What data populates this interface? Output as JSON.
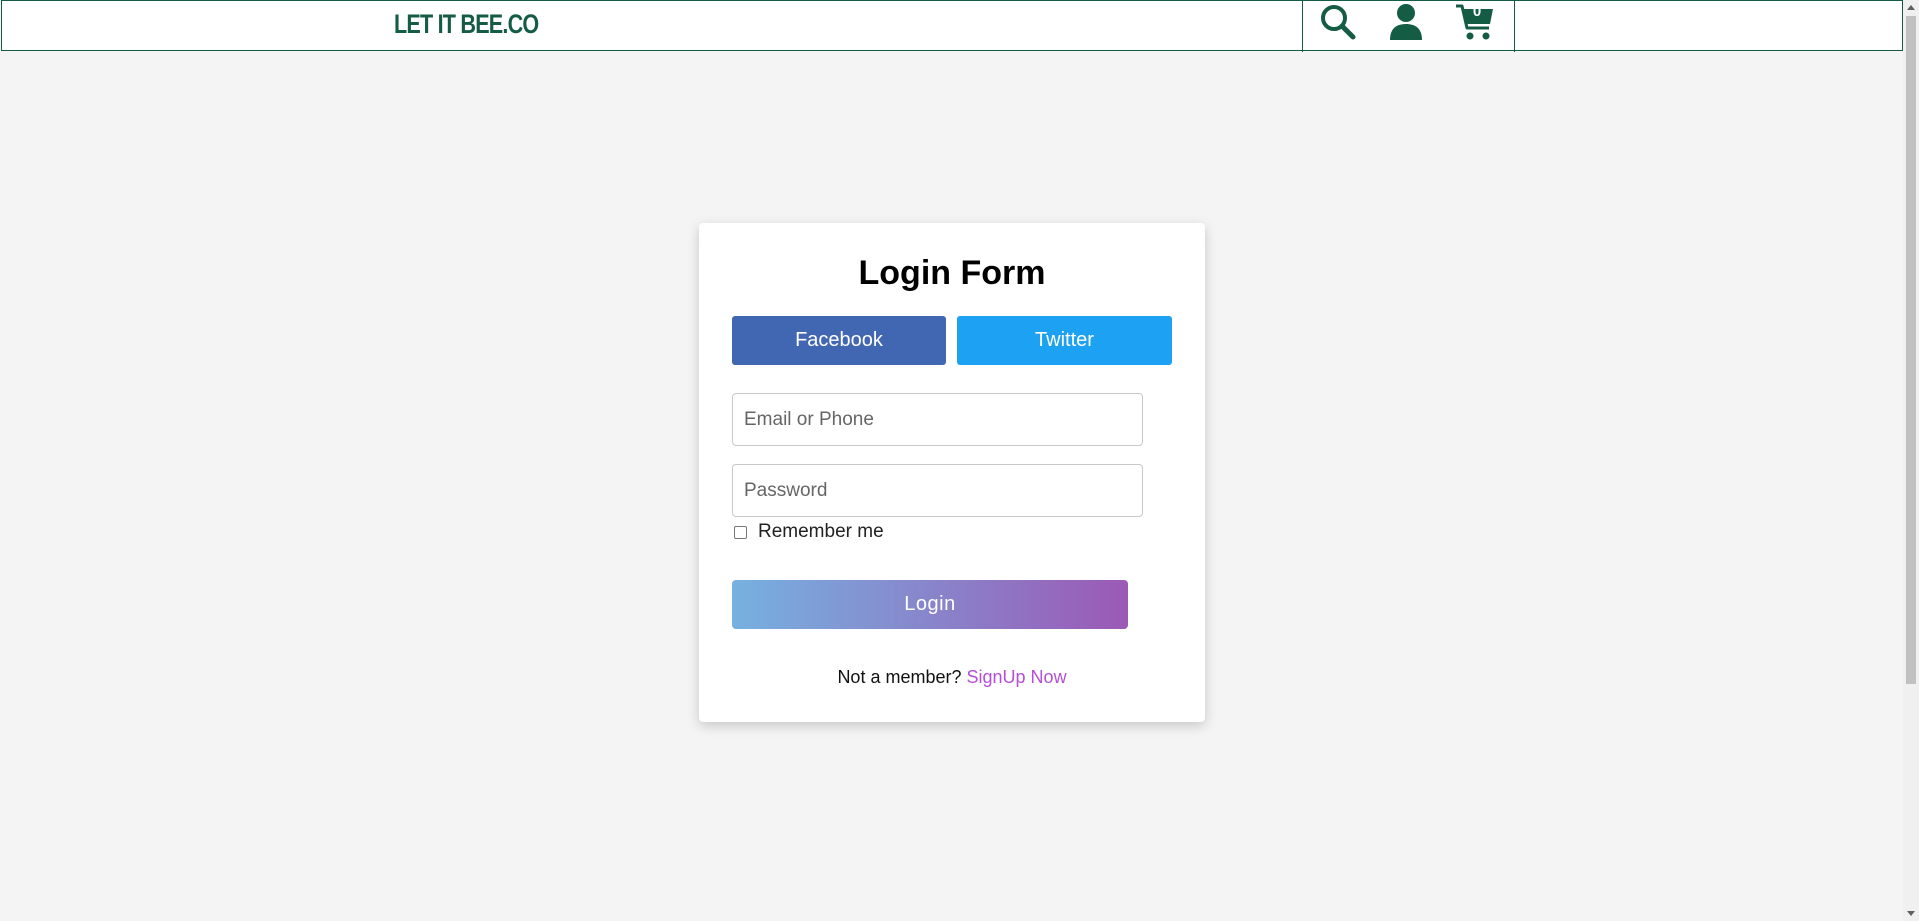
{
  "header": {
    "logo": "LET IT BEE.CO",
    "icons": [
      "search-icon",
      "user-icon",
      "cart-icon"
    ],
    "cart_count": "0",
    "brand_color": "#155c45"
  },
  "login": {
    "title": "Login Form",
    "facebook_label": "Facebook",
    "twitter_label": "Twitter",
    "email_placeholder": "Email or Phone",
    "email_value": "",
    "password_placeholder": "Password",
    "password_value": "",
    "remember_label": "Remember me",
    "remember_checked": false,
    "login_label": "Login",
    "signup_prompt": "Not a member?",
    "signup_link": "SignUp Now",
    "colors": {
      "facebook": "#4267b2",
      "twitter": "#1da1f2",
      "gradient_start": "#76b1e0",
      "gradient_end": "#9b59b6",
      "link": "#b44fd6"
    }
  }
}
